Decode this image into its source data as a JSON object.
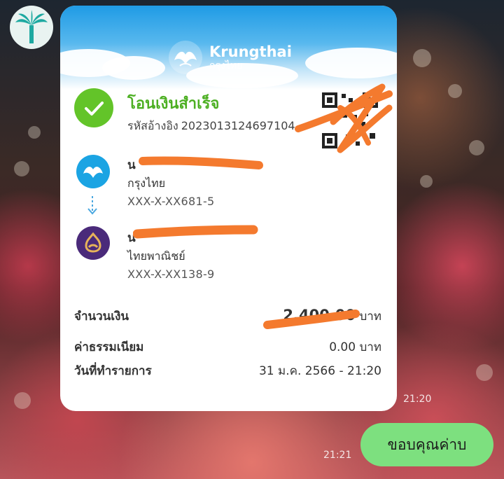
{
  "chat": {
    "slip_time": "21:20",
    "reply_time": "21:21",
    "reply_message": "ขอบคุณค่าบ"
  },
  "slip": {
    "bank_brand": "Krungthai",
    "bank_brand_thai": "กรุงไทย",
    "status_title": "โอนเงินสำเร็จ",
    "ref_label": "รหัสอ้างอิง",
    "ref_number": "2023013124697104",
    "sender": {
      "name": "น",
      "bank": "กรุงไทย",
      "account": "XXX-X-XX681-5"
    },
    "receiver": {
      "name": "น",
      "bank": "ไทยพาณิชย์",
      "account": "XXX-X-XX138-9"
    },
    "amount": {
      "label": "จำนวนเงิน",
      "value": "2,400.00",
      "unit": "บาท"
    },
    "fee": {
      "label": "ค่าธรรมเนียม",
      "value": "0.00 บาท"
    },
    "date": {
      "label": "วันที่ทำรายการ",
      "value": "31 ม.ค. 2566 - 21:20"
    }
  },
  "colors": {
    "success_green": "#63c429",
    "krungthai_blue": "#1ba4e3",
    "scb_purple": "#4a2a7a",
    "redaction_orange": "#f47a2e",
    "bubble_green": "#7de07f"
  },
  "icons": {
    "avatar": "palm-tree-icon",
    "status": "check-circle-icon",
    "sender_bank": "krungthai-bird-icon",
    "receiver_bank": "scb-logo-icon",
    "transfer_direction": "arrow-down-icon"
  }
}
